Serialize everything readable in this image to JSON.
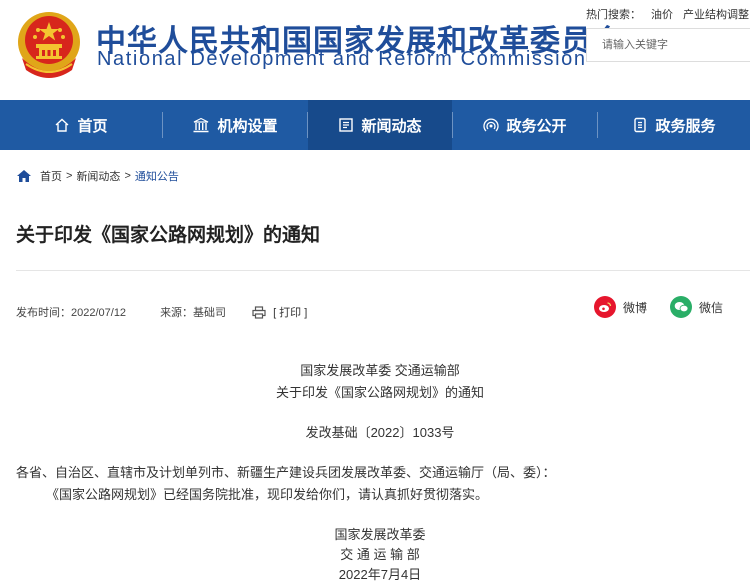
{
  "header": {
    "title_cn": "中华人民共和国国家发展和改革委员会",
    "title_en": "National Development and Reform Commission",
    "hot_search_label": "热门搜索：",
    "hot_terms": [
      "油价",
      "产业结构调整"
    ],
    "search_placeholder": "请输入关键字"
  },
  "nav": {
    "items": [
      {
        "label": "首页",
        "icon": "home-icon"
      },
      {
        "label": "机构设置",
        "icon": "building-icon"
      },
      {
        "label": "新闻动态",
        "icon": "newspaper-icon",
        "active": true
      },
      {
        "label": "政务公开",
        "icon": "broadcast-icon"
      },
      {
        "label": "政务服务",
        "icon": "document-icon"
      }
    ]
  },
  "breadcrumb": {
    "items": [
      "首页",
      "新闻动态",
      "通知公告"
    ],
    "separator": ">"
  },
  "article": {
    "title": "关于印发《国家公路网规划》的通知",
    "publish_time": "发布时间：2022/07/12",
    "source": "来源：基础司",
    "print_label": "[ 打印 ]"
  },
  "share": {
    "weibo": "微博",
    "weixin": "微信"
  },
  "doc": {
    "issuer": "国家发展改革委 交通运输部",
    "heading": "关于印发《国家公路网规划》的通知",
    "doc_number": "发改基础〔2022〕1033号",
    "recipients": "各省、自治区、直辖市及计划单列市、新疆生产建设兵团发展改革委、交通运输厅（局、委）：",
    "body": "《国家公路网规划》已经国务院批准，现印发给你们，请认真抓好贯彻落实。",
    "sign1": "国家发展改革委",
    "sign2": "交 通 运 输 部",
    "date": "2022年7月4日"
  },
  "colors": {
    "brand_blue": "#1f4d9a",
    "nav_bg": "#1f5aa3",
    "nav_active": "#174a8b",
    "weibo": "#e6162d",
    "weixin": "#2aae67"
  }
}
